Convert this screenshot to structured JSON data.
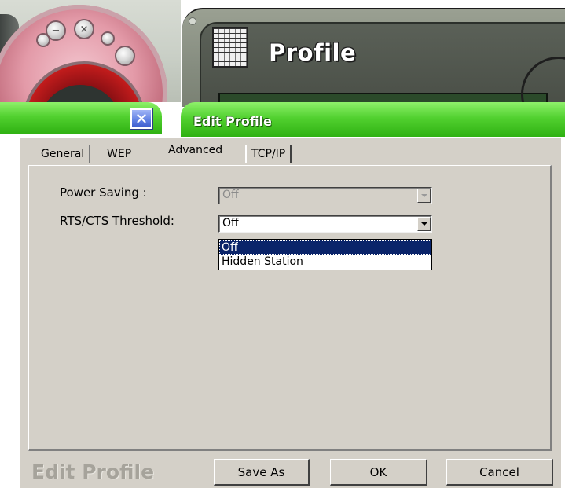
{
  "skin": {
    "title": "Profile"
  },
  "titlebar": {
    "close_glyph": "✕",
    "title": "Edit Profile"
  },
  "tabs": [
    {
      "label": "General"
    },
    {
      "label": "WEP"
    },
    {
      "label": "Advanced"
    },
    {
      "label": "TCP/IP"
    }
  ],
  "advanced": {
    "power_saving": {
      "label": "Power Saving :",
      "value": "Off"
    },
    "rts_cts": {
      "label": "RTS/CTS Threshold:",
      "value": "Off",
      "options": [
        "Off",
        "Hidden Station"
      ]
    }
  },
  "footer": {
    "title": "Edit Profile",
    "save_as": "Save As",
    "ok": "OK",
    "cancel": "Cancel"
  },
  "colors": {
    "titlebar_green": "#52d130",
    "dialog_face": "#d4d0c8",
    "selection": "#0a246a"
  }
}
